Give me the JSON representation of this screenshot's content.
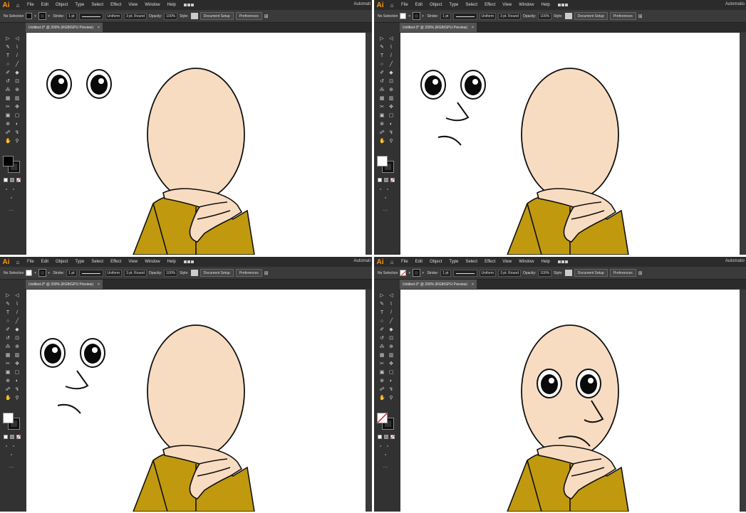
{
  "app": {
    "logo": "Ai",
    "menu": [
      "File",
      "Edit",
      "Object",
      "Type",
      "Select",
      "Effect",
      "View",
      "Window",
      "Help"
    ],
    "workspace_label": "Automatio",
    "workspace_label_short": "Automati"
  },
  "control_bar": {
    "selection_label": "No Selection",
    "stroke_label": "Stroke:",
    "stroke_weight": "1 pt",
    "profile": "Uniform",
    "brush": "3 pt. Round",
    "opacity_label": "Opacity:",
    "opacity_value": "100%",
    "style_label": "Style:",
    "doc_setup": "Document Setup",
    "preferences": "Preferences"
  },
  "document_tab": {
    "title": "Untitled-3* @ 200% (RGB/GPU Preview)",
    "close": "×"
  },
  "colors": {
    "skin": "#f8dcc1",
    "robe": "#c0990f",
    "outline": "#111111",
    "ui_dark": "#323232",
    "ai_orange": "#ff9a00"
  },
  "panels": [
    {
      "id": "step-1",
      "fill_swatch": "black",
      "features": [
        "eyes-detached"
      ]
    },
    {
      "id": "step-2",
      "fill_swatch": "white",
      "features": [
        "eyes-detached",
        "nose-detached",
        "mouth-detached"
      ]
    },
    {
      "id": "step-3",
      "fill_swatch": "white",
      "features": [
        "eyes-detached",
        "nose-detached",
        "mouth-detached"
      ]
    },
    {
      "id": "step-4",
      "fill_swatch": "none",
      "features": [
        "face-complete"
      ]
    }
  ]
}
